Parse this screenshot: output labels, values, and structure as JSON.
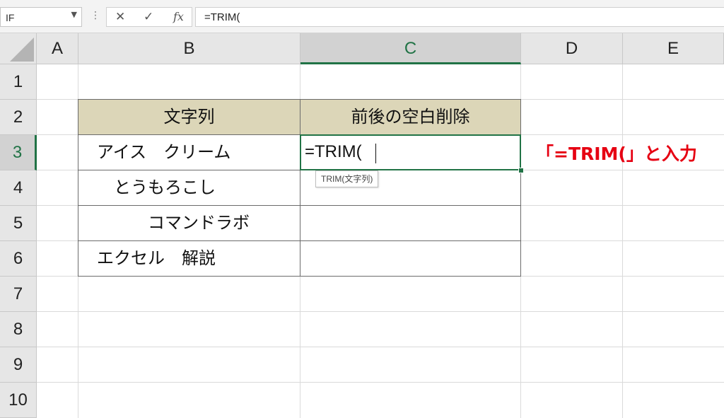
{
  "formula_bar": {
    "name_box": "IF",
    "cancel_symbol": "✕",
    "enter_symbol": "✓",
    "fx_label": "fx",
    "formula": "=TRIM("
  },
  "columns": [
    "A",
    "B",
    "C",
    "D",
    "E"
  ],
  "selected_column": "C",
  "rows": [
    "1",
    "2",
    "3",
    "4",
    "5",
    "6",
    "7",
    "8",
    "9",
    "10"
  ],
  "selected_row": "3",
  "table": {
    "header_b": "文字列",
    "header_c": "前後の空白削除",
    "b_values": [
      "　アイス　クリーム",
      "　　とうもろこし",
      "　　　　コマンドラボ",
      "　エクセル　解説"
    ],
    "c3_editing": "=TRIM(",
    "header_fill": "#dcd6b8"
  },
  "tooltip": "TRIM(文字列)",
  "annotation": {
    "text": "「=TRIM(」と入力",
    "color": "#e60012"
  },
  "accent_color": "#217346"
}
